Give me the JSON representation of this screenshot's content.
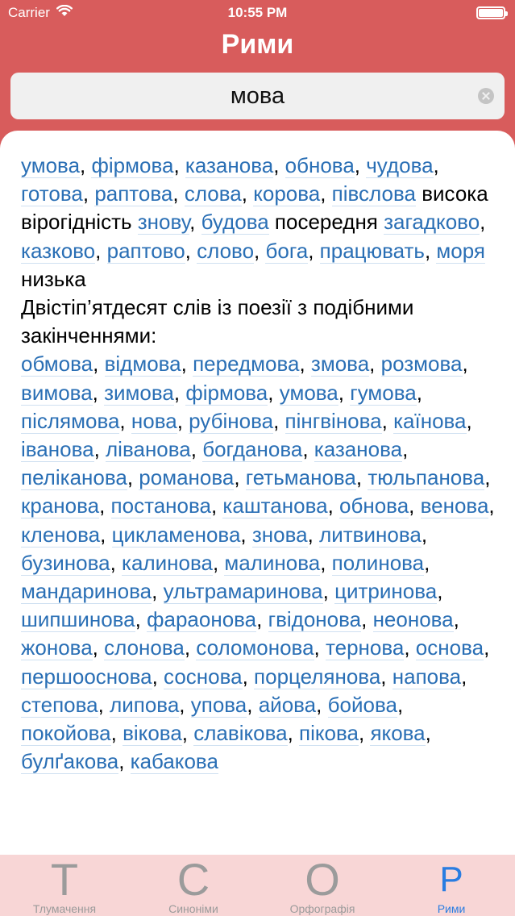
{
  "status_bar": {
    "carrier": "Carrier",
    "time": "10:55 PM"
  },
  "nav": {
    "title": "Рими"
  },
  "search": {
    "value": "мова"
  },
  "rhymes": {
    "top": [
      "умова",
      "фірмова",
      "казанова",
      "обнова",
      "чудова",
      "готова",
      "раптова",
      "слова",
      "корова",
      "півслова"
    ],
    "high_label": "висока вірогідність",
    "high": [
      "знову",
      "будова"
    ],
    "mid_label": "посередня",
    "mid": [
      "загадково",
      "казково",
      "раптово",
      "слово",
      "бога",
      "працювать",
      "моря"
    ],
    "low_label": "низька",
    "poetry_heading": "Двістіп’ятдесят слів із поезії з подібними закінченнями:",
    "poetry": [
      "обмова",
      "відмова",
      "передмова",
      "змова",
      "розмова",
      "вимова",
      "зимова",
      "фірмова",
      "умова",
      "гумова",
      "післямова",
      "нова",
      "рубінова",
      "пінгвінова",
      "каїнова",
      "іванова",
      "ліванова",
      "богданова",
      "казанова",
      "пеліканова",
      "романова",
      "гетьманова",
      "тюльпанова",
      "кранова",
      "постанова",
      "каштанова",
      "обнова",
      "венова",
      "кленова",
      "цикламенова",
      "знова",
      "литвинова",
      "бузинова",
      "калинова",
      "малинова",
      "полинова",
      "мандаринова",
      "ультрамаринова",
      "цитринова",
      "шипшинова",
      "фараонова",
      "гвідонова",
      "неонова",
      "жонова",
      "слонова",
      "соломонова",
      "тернова",
      "основа",
      "першооснова",
      "соснова",
      "порцелянова",
      "напова",
      "степова",
      "липова",
      "упова",
      "айова",
      "бойова",
      "покойова",
      "вікова",
      "славікова",
      "пікова",
      "якова",
      "булґакова",
      "кабакова"
    ]
  },
  "tabs": [
    {
      "glyph": "Т",
      "label": "Тлумачення",
      "icon": "letter-t-icon"
    },
    {
      "glyph": "С",
      "label": "Синоніми",
      "icon": "letter-s-icon"
    },
    {
      "glyph": "О",
      "label": "Орфографія",
      "icon": "letter-o-icon"
    },
    {
      "glyph": "Р",
      "label": "Рими",
      "icon": "letter-r-icon"
    }
  ],
  "colors": {
    "header": "#d85c5c",
    "link": "#2a6fb5",
    "tab_active": "#2a7de1",
    "tab_bar": "#f8d6d6"
  }
}
